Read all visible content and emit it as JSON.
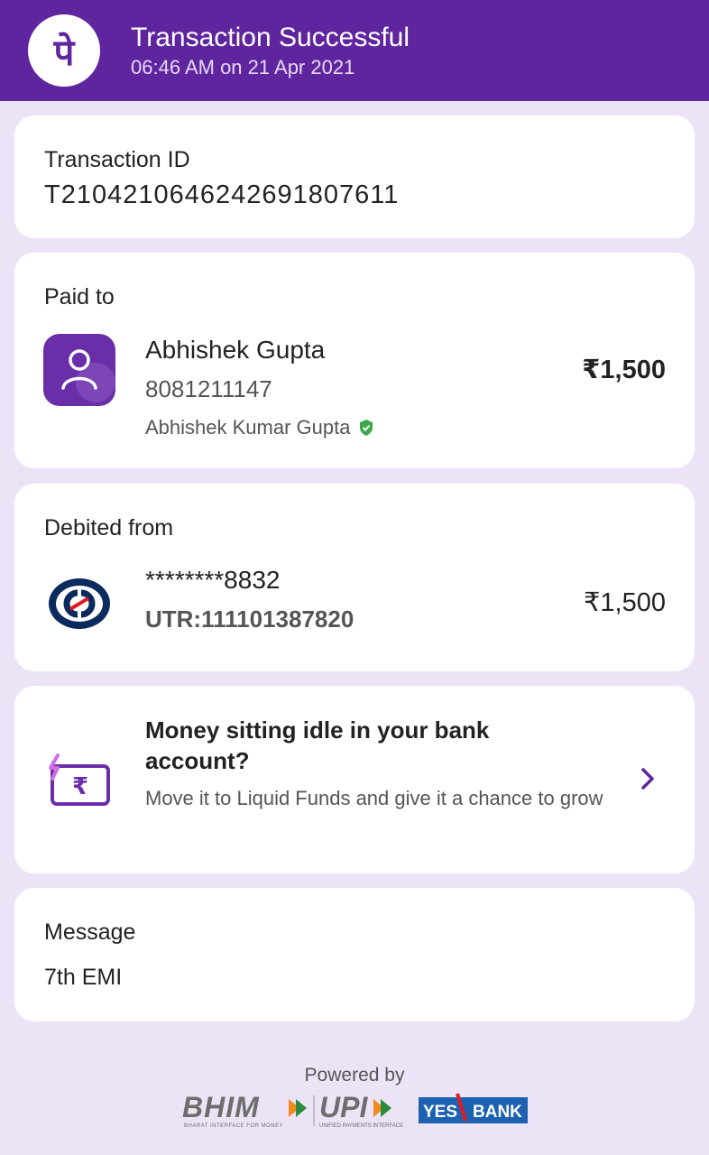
{
  "header": {
    "title": "Transaction Successful",
    "datetime": "06:46 AM on 21 Apr 2021",
    "logo_glyph": "पे",
    "bg_color": "#5f259f"
  },
  "transaction": {
    "label": "Transaction ID",
    "id": "T2104210646242691807611"
  },
  "paid_to": {
    "label": "Paid to",
    "name": "Abhishek Gupta",
    "phone": "8081211147",
    "verified_name": "Abhishek Kumar Gupta",
    "verified_icon": "verified-shield-icon",
    "amount": "₹1,500",
    "avatar_icon": "person-icon"
  },
  "debited_from": {
    "label": "Debited from",
    "account": "********8832",
    "utr": "UTR:111101387820",
    "amount": "₹1,500",
    "bank_icon": "kotak-bank-icon"
  },
  "promo": {
    "title": "Money sitting idle in your bank account?",
    "description": "Move it to Liquid Funds and give it a chance to grow",
    "icon": "rupee-note-icon"
  },
  "message": {
    "label": "Message",
    "text": "7th EMI"
  },
  "footer": {
    "powered_by": "Powered by",
    "bhim": "BHIM",
    "bhim_tagline": "BHARAT INTERFACE FOR MONEY",
    "upi": "UPI",
    "upi_tagline": "UNIFIED PAYMENTS INTERFACE",
    "bank_yes": "YES",
    "bank_name": "BANK"
  }
}
